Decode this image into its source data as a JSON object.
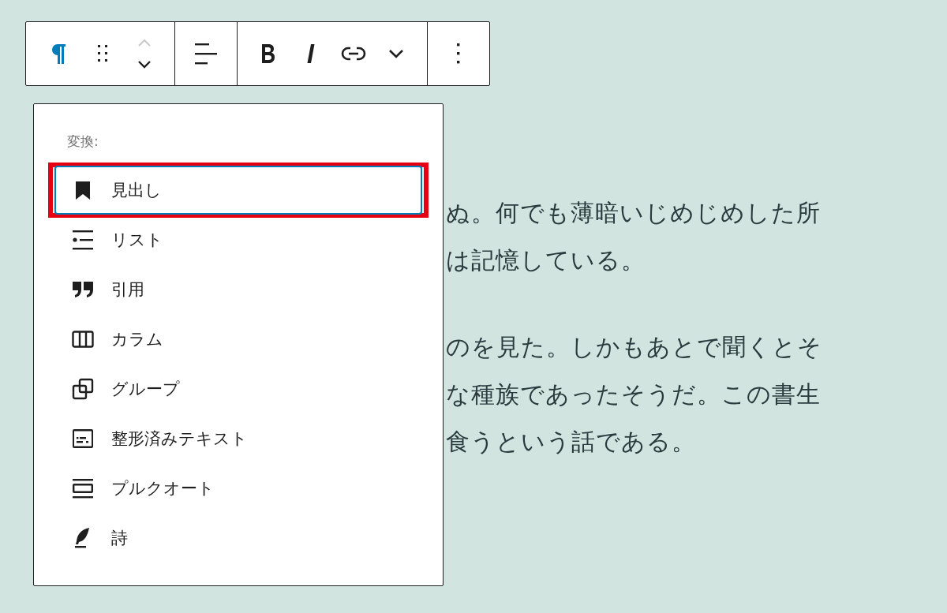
{
  "toolbar": {
    "groups": [
      {
        "buttons": [
          {
            "kind": "paragraph",
            "disabled": false
          },
          {
            "kind": "drag",
            "disabled": false
          },
          {
            "kind": "mover",
            "up_disabled": true,
            "disabled": false
          }
        ]
      },
      {
        "buttons": [
          {
            "kind": "align",
            "disabled": false
          }
        ]
      },
      {
        "buttons": [
          {
            "kind": "bold",
            "disabled": false
          },
          {
            "kind": "italic",
            "disabled": false
          },
          {
            "kind": "link",
            "disabled": false
          },
          {
            "kind": "more-options",
            "disabled": false
          }
        ]
      },
      {
        "buttons": [
          {
            "kind": "kebab",
            "disabled": false
          }
        ]
      }
    ]
  },
  "transform_menu": {
    "label": "変換:",
    "items": [
      {
        "kind": "heading",
        "label": "見出し",
        "selected": true,
        "highlighted": true
      },
      {
        "kind": "list",
        "label": "リスト",
        "selected": false,
        "highlighted": false
      },
      {
        "kind": "quote",
        "label": "引用",
        "selected": false,
        "highlighted": false
      },
      {
        "kind": "columns",
        "label": "カラム",
        "selected": false,
        "highlighted": false
      },
      {
        "kind": "group",
        "label": "グループ",
        "selected": false,
        "highlighted": false
      },
      {
        "kind": "preformatted",
        "label": "整形済みテキスト",
        "selected": false,
        "highlighted": false
      },
      {
        "kind": "pullquote",
        "label": "プルクオート",
        "selected": false,
        "highlighted": false
      },
      {
        "kind": "verse",
        "label": "詩",
        "selected": false,
        "highlighted": false
      }
    ]
  },
  "paragraphs": [
    {
      "lines": [
        "ぬ。何でも薄暗いじめじめした所",
        "は記憶している。"
      ]
    },
    {
      "lines": [
        "のを見た。しかもあとで聞くとそ",
        "な種族であったそうだ。この書生",
        "食うという話である。"
      ]
    }
  ]
}
